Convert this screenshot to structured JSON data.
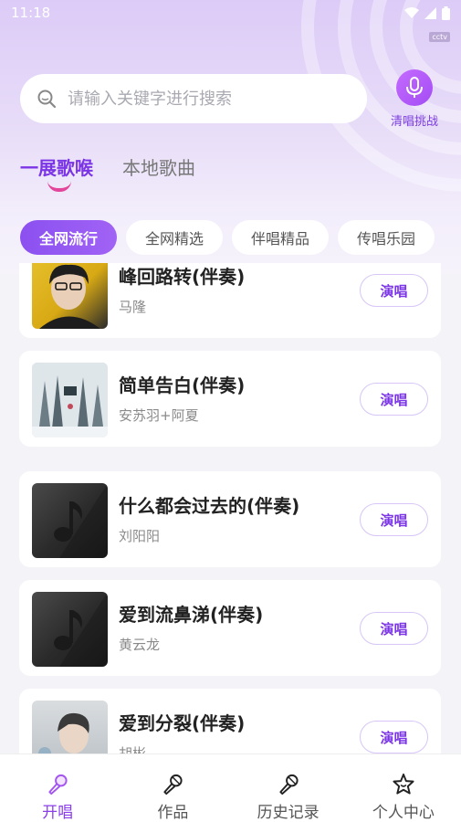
{
  "status_bar": {
    "time": "11:18"
  },
  "badge": "cctv",
  "search": {
    "placeholder": "请输入关键字进行搜索"
  },
  "mic_button": {
    "label": "清唱挑战"
  },
  "tabs": [
    {
      "label": "一展歌喉",
      "active": true
    },
    {
      "label": "本地歌曲",
      "active": false
    }
  ],
  "categories": [
    {
      "label": "全网流行",
      "active": true
    },
    {
      "label": "全网精选",
      "active": false
    },
    {
      "label": "伴唱精品",
      "active": false
    },
    {
      "label": "传唱乐园",
      "active": false
    }
  ],
  "songs": [
    {
      "title": "峰回路转(伴奏)",
      "artist": "马隆",
      "action": "演唱",
      "cover": "portrait-yellow"
    },
    {
      "title": "简单告白(伴奏)",
      "artist": "安苏羽+阿夏",
      "action": "演唱",
      "cover": "winter-forest"
    },
    {
      "title": "什么都会过去的(伴奏)",
      "artist": "刘阳阳",
      "action": "演唱",
      "cover": "music-note-placeholder"
    },
    {
      "title": "爱到流鼻涕(伴奏)",
      "artist": "黄云龙",
      "action": "演唱",
      "cover": "music-note-placeholder"
    },
    {
      "title": "爱到分裂(伴奏)",
      "artist": "胡彬",
      "action": "演唱",
      "cover": "portrait-grey"
    }
  ],
  "bottom_nav": [
    {
      "label": "开唱",
      "icon": "microphone-icon",
      "active": true
    },
    {
      "label": "作品",
      "icon": "microphone-icon",
      "active": false
    },
    {
      "label": "历史记录",
      "icon": "microphone-icon",
      "active": false
    },
    {
      "label": "个人中心",
      "icon": "star-face-icon",
      "active": false
    }
  ],
  "colors": {
    "accent": "#7b35e6",
    "pink": "#e3459a",
    "chip_active": "#8b50f0"
  }
}
